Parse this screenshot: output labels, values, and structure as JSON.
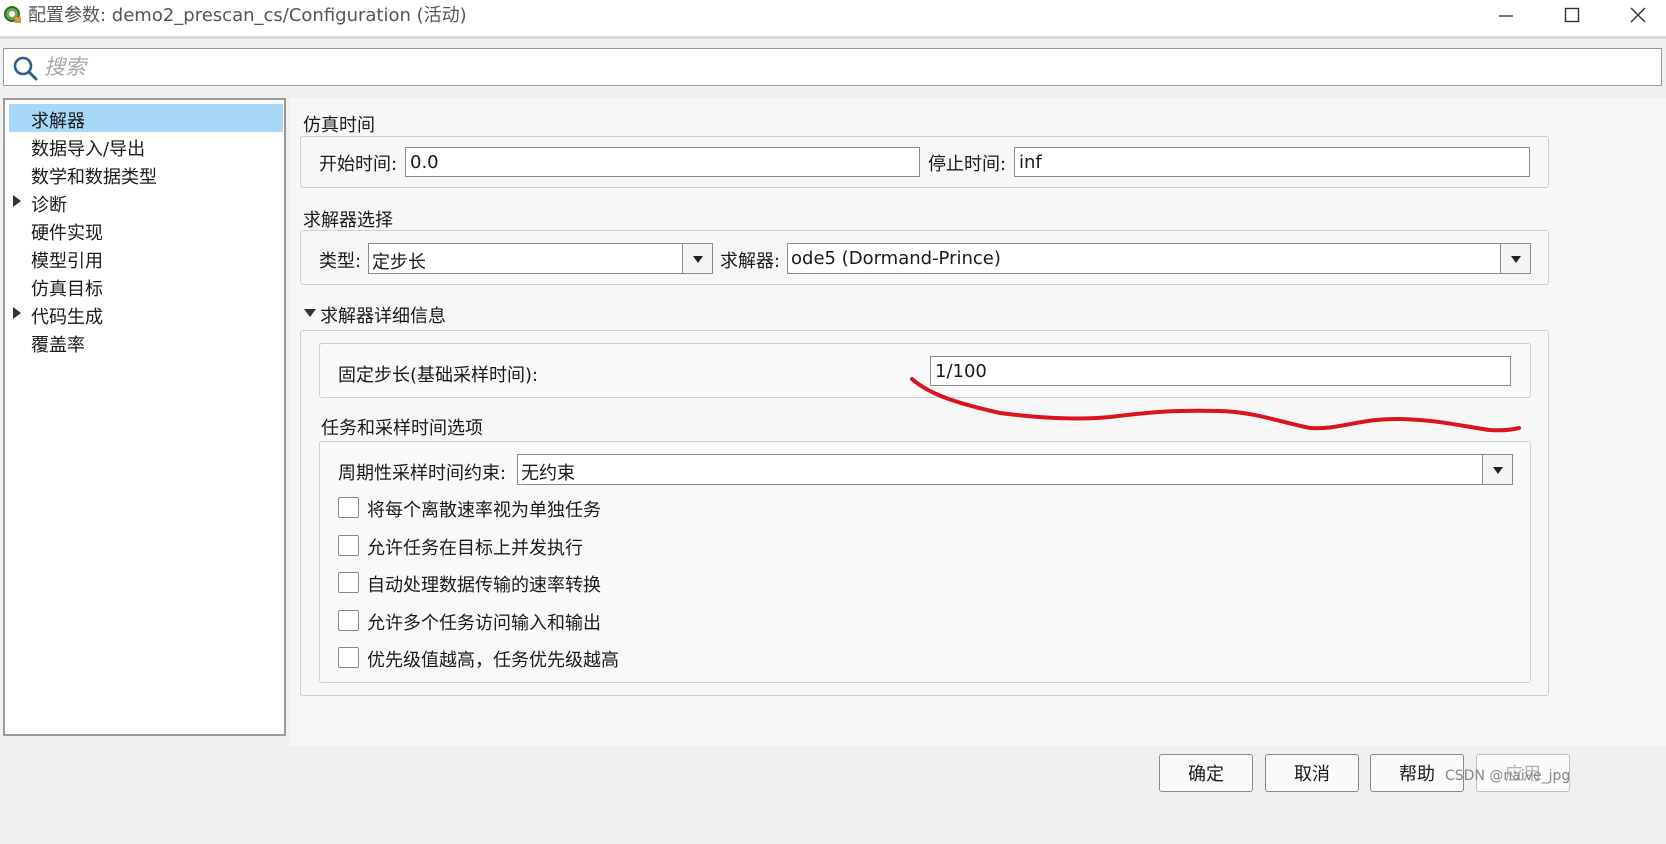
{
  "window": {
    "title": "配置参数: demo2_prescan_cs/Configuration (活动)"
  },
  "search": {
    "placeholder": "搜索"
  },
  "sidebar": {
    "items": [
      {
        "label": "求解器",
        "selected": true,
        "expandable": false
      },
      {
        "label": "数据导入/导出",
        "selected": false,
        "expandable": false
      },
      {
        "label": "数学和数据类型",
        "selected": false,
        "expandable": false
      },
      {
        "label": "诊断",
        "selected": false,
        "expandable": true
      },
      {
        "label": "硬件实现",
        "selected": false,
        "expandable": false
      },
      {
        "label": "模型引用",
        "selected": false,
        "expandable": false
      },
      {
        "label": "仿真目标",
        "selected": false,
        "expandable": false
      },
      {
        "label": "代码生成",
        "selected": false,
        "expandable": true
      },
      {
        "label": "覆盖率",
        "selected": false,
        "expandable": false
      }
    ],
    "selected_color": "#a8d8f8"
  },
  "sim_time": {
    "title": "仿真时间",
    "start_label": "开始时间:",
    "start_value": "0.0",
    "stop_label": "停止时间:",
    "stop_value": "inf"
  },
  "solver_select": {
    "title": "求解器选择",
    "type_label": "类型:",
    "type_value": "定步长",
    "solver_label": "求解器:",
    "solver_value": "ode5 (Dormand-Prince)"
  },
  "solver_details": {
    "title": "求解器详细信息",
    "step_label": "固定步长(基础采样时间):",
    "step_value": "1/100"
  },
  "tasking": {
    "title": "任务和采样时间选项",
    "constraint_label": "周期性采样时间约束:",
    "constraint_value": "无约束",
    "options": [
      {
        "label": "将每个离散速率视为单独任务",
        "checked": false
      },
      {
        "label": "允许任务在目标上并发执行",
        "checked": false
      },
      {
        "label": "自动处理数据传输的速率转换",
        "checked": false
      },
      {
        "label": "允许多个任务访问输入和输出",
        "checked": false
      },
      {
        "label": "优先级值越高，任务优先级越高",
        "checked": false
      }
    ]
  },
  "footer": {
    "ok": "确定",
    "cancel": "取消",
    "help": "帮助",
    "apply": "应用"
  },
  "annotation": {
    "color": "#d9141c"
  },
  "watermark": "CSDN @naive_jpg"
}
